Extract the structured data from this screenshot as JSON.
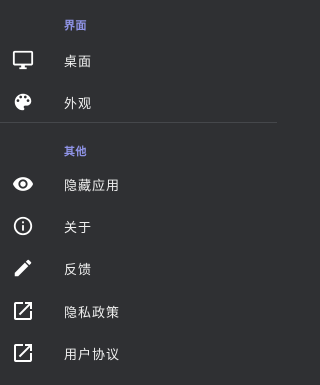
{
  "sections": [
    {
      "header": "界面",
      "items": [
        {
          "label": "桌面",
          "icon": "monitor-icon"
        },
        {
          "label": "外观",
          "icon": "palette-icon"
        }
      ]
    },
    {
      "header": "其他",
      "items": [
        {
          "label": "隐藏应用",
          "icon": "eye-icon"
        },
        {
          "label": "关于",
          "icon": "info-icon"
        },
        {
          "label": "反馈",
          "icon": "pencil-icon"
        },
        {
          "label": "隐私政策",
          "icon": "open-in-new-icon"
        },
        {
          "label": "用户协议",
          "icon": "open-in-new-icon"
        }
      ]
    }
  ],
  "colors": {
    "background": "#2f3033",
    "section_header": "#8f93e6",
    "text": "#efefef",
    "divider": "#45474b"
  }
}
